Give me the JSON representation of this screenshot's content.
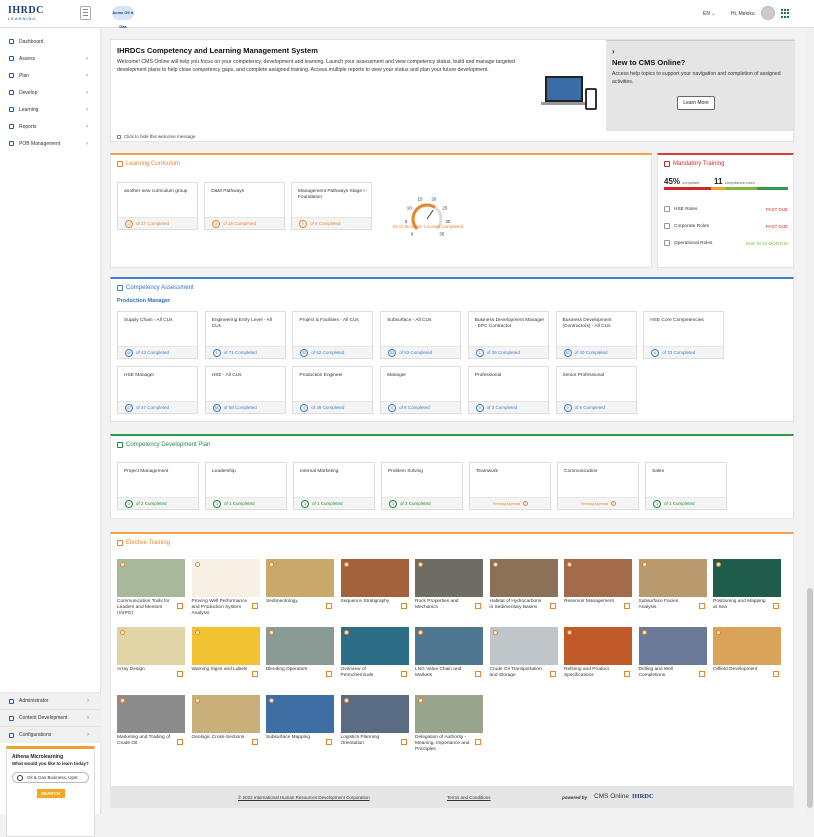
{
  "topbar": {
    "logo": "IHRDC",
    "logo_sub": "LEARNING",
    "brand": "Acme Oil & Gas",
    "lang": "EN",
    "lang_chev": "⌄",
    "greeting": "Hi, Meloku"
  },
  "sidebar": {
    "items": [
      {
        "label": "Dashboard",
        "icon": "dashboard-icon"
      },
      {
        "label": "Assess",
        "icon": "assess-icon",
        "chev": "›"
      },
      {
        "label": "Plan",
        "icon": "plan-icon",
        "chev": "›"
      },
      {
        "label": "Develop",
        "icon": "develop-icon",
        "chev": "›"
      },
      {
        "label": "Learning",
        "icon": "learning-icon",
        "chev": "›"
      },
      {
        "label": "Reports",
        "icon": "reports-icon",
        "chev": "›"
      },
      {
        "label": "POB Management",
        "icon": "pob-icon",
        "chev": "›"
      }
    ],
    "bottom": [
      {
        "label": "Administrator",
        "chev": "›"
      },
      {
        "label": "Content Development",
        "chev": "›"
      },
      {
        "label": "Configurations",
        "chev": "›"
      }
    ],
    "micro": {
      "title": "Athena Microlearning",
      "question": "What would you like to learn today?",
      "input_value": "Oil & Gas Business, Upst",
      "button": "SEARCH"
    }
  },
  "welcome": {
    "title": "IHRDCs Competency and Learning Management System",
    "body": "Welcome! CMS Online will help you focus on your competency, development and learning. Launch your assessment and view competency status, build and manage targeted development plans to help close competency gaps, and complete assigned training. Access multiple reports to view your status and plan your future development.",
    "hide_label": "Click to hide this welcome message",
    "cms_arrow": "›",
    "cms_title": "New to CMS Online?",
    "cms_body": "Access help topics to support your navigation and completion of assigned activities.",
    "learn_more": "Learn More"
  },
  "learning_curriculum": {
    "title": "Learning Curriculum",
    "cards": [
      {
        "name": "another new curriculum group",
        "ring": "12",
        "count": "of 17 Completed"
      },
      {
        "name": "O&M Pathways",
        "ring": "10",
        "count": "of 16 Completed"
      },
      {
        "name": "Management Pathways Stage I - Foundation",
        "ring": "0",
        "count": "of 5 Completed"
      }
    ],
    "gauge": {
      "value": 22,
      "max": 35,
      "ticks": [
        "0",
        "5",
        "10",
        "15",
        "20",
        "25",
        "30",
        "35"
      ],
      "label": "22 of 35 Active Courses Completed"
    }
  },
  "mandatory_training": {
    "title": "Mandatory Training",
    "pct": "45%",
    "pct_label": "compliant",
    "count": "11",
    "count_label": "compliance roles",
    "rows": [
      {
        "name": "HSE Roles",
        "status": "PAST DUE",
        "color": "#d02828"
      },
      {
        "name": "Corporate Roles",
        "status": "PAST DUE",
        "color": "#d02828"
      },
      {
        "name": "Operational Roles",
        "status": "DUE IN 12 MONTHS",
        "color": "#7db83a"
      }
    ]
  },
  "competency_assessment": {
    "title": "Competency Assessment",
    "subtitle": "Production Manager",
    "cards": [
      {
        "name": "Supply Chain - All CUs",
        "ring": "40",
        "count": "of 43 Completed"
      },
      {
        "name": "Engineering Entry Level - All CUs",
        "ring": "1",
        "count": "of 71 Completed"
      },
      {
        "name": "Project & Facilities - All CUs",
        "ring": "52",
        "count": "of 52 Completed"
      },
      {
        "name": "Subsurface - All CUs",
        "ring": "53",
        "count": "of 53 Completed"
      },
      {
        "name": "Business Development Manager - EPC Contractor",
        "ring": "1",
        "count": "of 36 Completed"
      },
      {
        "name": "Business Development (Contractors) - All CUs",
        "ring": "40",
        "count": "of 40 Completed"
      },
      {
        "name": "HSE Core Competencies",
        "ring": "0",
        "count": "of 33 Completed"
      },
      {
        "name": "HSE Manager",
        "ring": "47",
        "count": "of 47 Completed"
      },
      {
        "name": "HSE - All CUs",
        "ring": "58",
        "count": "of 58 Completed"
      },
      {
        "name": "Production Engineer",
        "ring": "0",
        "count": "of 39 Completed"
      },
      {
        "name": "Manager",
        "ring": "0",
        "count": "of 8 Completed"
      },
      {
        "name": "Professional",
        "ring": "0",
        "count": "of 3 Completed"
      },
      {
        "name": "Senior Professional",
        "ring": "0",
        "count": "of 6 Completed"
      }
    ]
  },
  "cdp": {
    "title": "Competency Development Plan",
    "cards": [
      {
        "name": "Project Management",
        "ring": "2",
        "count": "of 2 Completed"
      },
      {
        "name": "Leadership",
        "ring": "1",
        "count": "of 1 Completed"
      },
      {
        "name": "Internal Marketing",
        "ring": "1",
        "count": "of 1 Completed"
      },
      {
        "name": "Problem Solving",
        "ring": "1",
        "count": "of 3 Completed"
      },
      {
        "name": "Teamwork",
        "pending": "Pending Approval"
      },
      {
        "name": "Communication",
        "pending": "Pending Approval"
      },
      {
        "name": "Sales",
        "ring": "1",
        "count": "of 1 Completed"
      }
    ]
  },
  "elective": {
    "title": "Elective Training",
    "tiles": [
      {
        "name": "Communication Tools for Leaders and Mentors (IAIPG)",
        "color": "#a7b99a"
      },
      {
        "name": "Proving Well Performance and Production System Analysis",
        "color": "#f6f1e4"
      },
      {
        "name": "Sedimentology",
        "color": "#c9a86b"
      },
      {
        "name": "Sequence Stratigraphy",
        "color": "#a3623b"
      },
      {
        "name": "Rock Properties and Mechanics",
        "color": "#6f6c66"
      },
      {
        "name": "Habitat of Hydrocarbons in Sedimentary Basins",
        "color": "#8c7158"
      },
      {
        "name": "Reservoir Management",
        "color": "#a36b4a"
      },
      {
        "name": "Subsurface Facies Analysis",
        "color": "#b99a6e"
      },
      {
        "name": "Positioning and Mapping at Sea",
        "color": "#1f5c4a"
      },
      {
        "name": "Array Design",
        "color": "#e0d3a6"
      },
      {
        "name": "Warning Signs and Labels",
        "color": "#f1c232"
      },
      {
        "name": "Blending Operators",
        "color": "#8a9a94"
      },
      {
        "name": "Overview of Petrochemicals",
        "color": "#2d6e86"
      },
      {
        "name": "LNG Value Chain and Markets",
        "color": "#4f7791"
      },
      {
        "name": "Crude Oil Transportation and Storage",
        "color": "#bfc5c9"
      },
      {
        "name": "Refining and Product Specifications",
        "color": "#c05a28"
      },
      {
        "name": "Drilling and Well Completions",
        "color": "#6b7a99"
      },
      {
        "name": "Oilfield Development",
        "color": "#d9a35a"
      },
      {
        "name": "Marketing and Trading of Crude Oil",
        "color": "#8c8c8c"
      },
      {
        "name": "Geologic Cross-Sections",
        "color": "#c9b07a"
      },
      {
        "name": "Subsurface Mapping",
        "color": "#3e6ea3"
      },
      {
        "name": "Logistics Planning Orientation",
        "color": "#5a6b84"
      },
      {
        "name": "Delegation of Authority - Meaning, Importance and Principles",
        "color": "#98a48c"
      }
    ]
  },
  "footer": {
    "copyright": "© 2022 International Human Resources Development Corporation",
    "terms": "Terms and Conditions",
    "powered": "powered by",
    "product": "CMS Online",
    "company": "IHRDC"
  },
  "colors": {
    "orange": "#e8852a",
    "blue": "#2f70c2",
    "green": "#278a40",
    "red": "#d02828"
  }
}
